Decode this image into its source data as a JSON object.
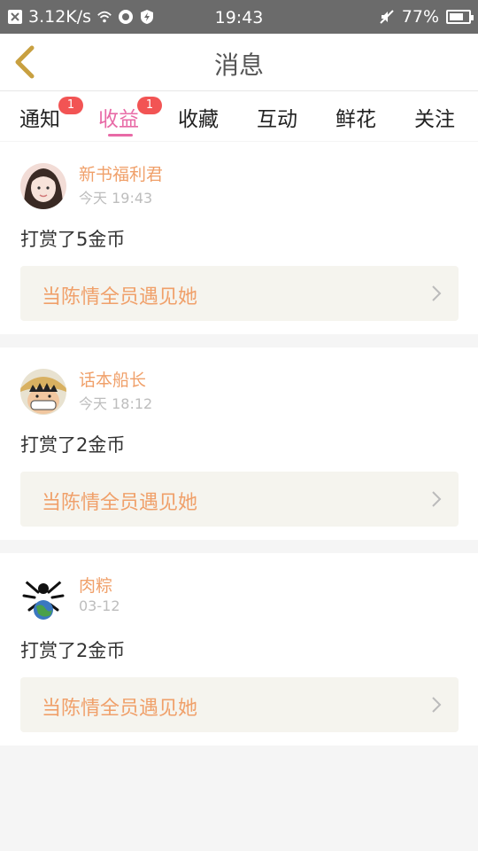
{
  "status_bar": {
    "speed": "3.12K/s",
    "time": "19:43",
    "battery": "77%",
    "battery_level": 0.77,
    "icons": [
      "notification-x-icon",
      "wifi-icon",
      "app-icon",
      "shield-icon",
      "mute-icon",
      "battery-icon"
    ]
  },
  "header": {
    "title": "消息",
    "back_icon": "chevron-left-icon",
    "accent_color": "#c8a040"
  },
  "tabs": [
    {
      "label": "通知",
      "badge": "1",
      "active": false
    },
    {
      "label": "收益",
      "badge": "1",
      "active": true
    },
    {
      "label": "收藏",
      "badge": "",
      "active": false
    },
    {
      "label": "互动",
      "badge": "",
      "active": false
    },
    {
      "label": "鲜花",
      "badge": "",
      "active": false
    },
    {
      "label": "关注",
      "badge": "",
      "active": false
    }
  ],
  "messages": [
    {
      "name": "新书福利君",
      "time": "今天 19:43",
      "text": "打赏了5金币",
      "book": "当陈情全员遇见她",
      "avatar": "girl-avatar-icon"
    },
    {
      "name": "话本船长",
      "time": "今天 18:12",
      "text": "打赏了2金币",
      "book": "当陈情全员遇见她",
      "avatar": "pirate-avatar-icon"
    },
    {
      "name": "肉粽",
      "time": "03-12",
      "text": "打赏了2金币",
      "book": "当陈情全员遇见她",
      "avatar": "globe-avatar-icon"
    }
  ],
  "colors": {
    "active_tab": "#e86aa6",
    "name_text": "#f0a06a",
    "badge": "#f25454"
  }
}
